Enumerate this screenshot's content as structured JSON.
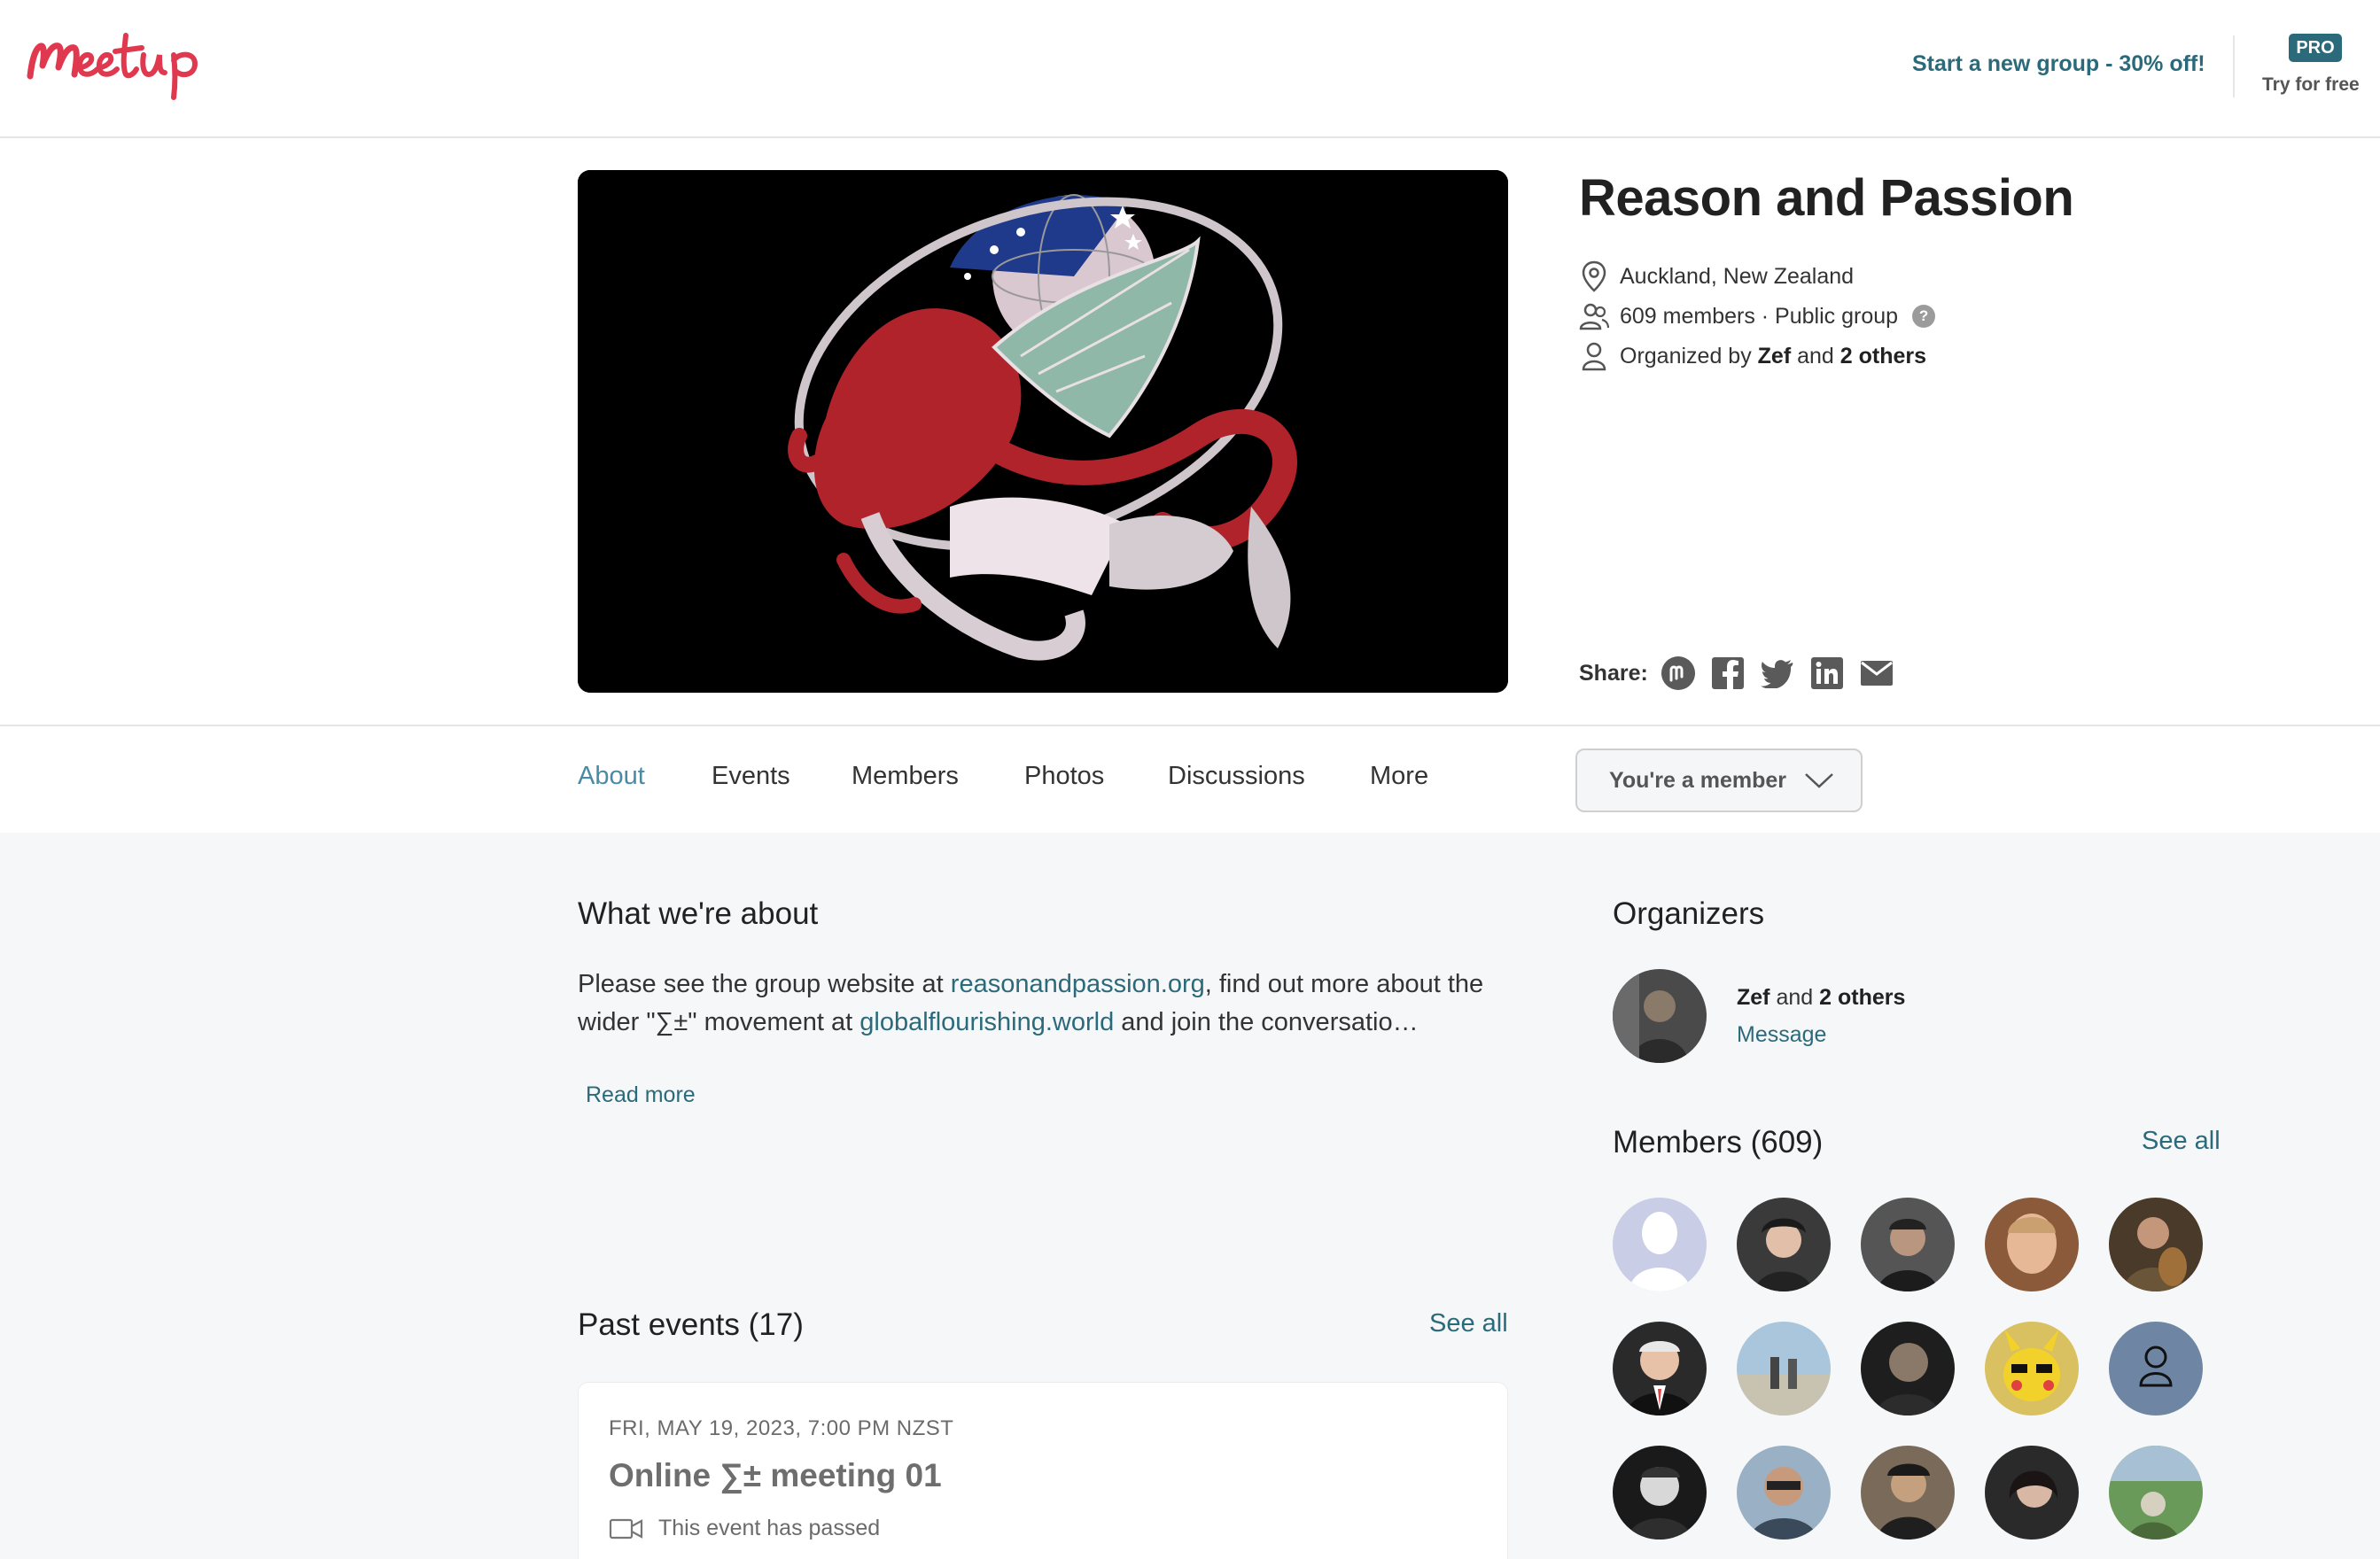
{
  "header": {
    "logo_text": "Meetup",
    "promo_link": "Start a new group - 30% off!",
    "pro_badge": "PRO",
    "try_free": "Try for free"
  },
  "group": {
    "name": "Reason and Passion",
    "location": "Auckland, New Zealand",
    "members_text": "609 members · Public group",
    "organized_prefix": "Organized by",
    "organizer_name": "Zef",
    "organized_and": "and",
    "organized_others": "2 others"
  },
  "share": {
    "label": "Share:",
    "icons": [
      "meetup-icon",
      "facebook-icon",
      "twitter-icon",
      "linkedin-icon",
      "email-icon"
    ]
  },
  "tabs": [
    {
      "label": "About",
      "active": true
    },
    {
      "label": "Events"
    },
    {
      "label": "Members"
    },
    {
      "label": "Photos"
    },
    {
      "label": "Discussions"
    },
    {
      "label": "More"
    }
  ],
  "membership_button": "You're a member",
  "about": {
    "title": "What we're about",
    "text_1": "Please see the group website at ",
    "link_1": "reasonandpassion.org",
    "text_2": ", find out more about the wider \"∑±\" movement at ",
    "link_2": "globalflourishing.world",
    "text_3": " and join the conversatio…",
    "read_more": "Read more"
  },
  "past_events": {
    "title": "Past events (17)",
    "see_all": "See all",
    "event": {
      "date": "FRI, MAY 19, 2023, 7:00 PM NZST",
      "title": "Online ∑± meeting 01",
      "status": "This event has passed"
    }
  },
  "organizers": {
    "title": "Organizers",
    "name": "Zef",
    "and": "and",
    "others": "2 others",
    "message": "Message"
  },
  "members": {
    "title": "Members (609)",
    "see_all": "See all"
  },
  "colors": {
    "brand_red": "#e0394f",
    "link_teal": "#2b6a7b",
    "active_tab": "#4a8aa5",
    "pro_bg": "#2b6a7b"
  }
}
